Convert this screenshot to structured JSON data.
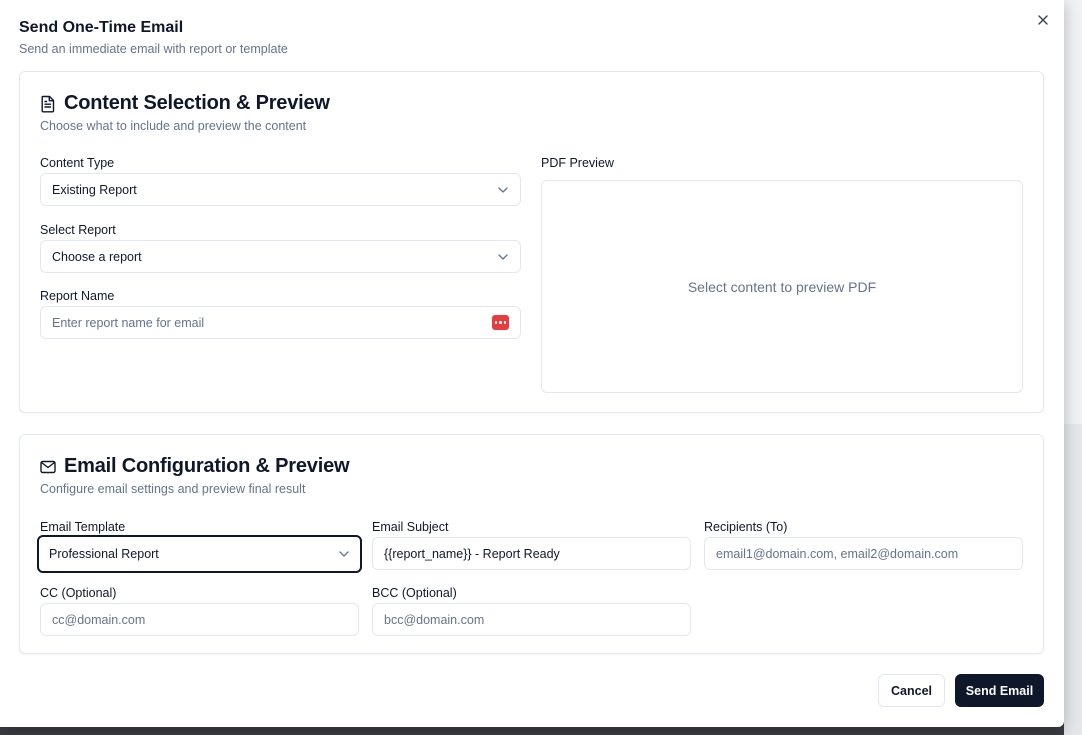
{
  "dialog": {
    "title": "Send One-Time Email",
    "description": "Send an immediate email with report or template",
    "close_icon": "close-icon"
  },
  "content_section": {
    "title": "Content Selection & Preview",
    "subtitle": "Choose what to include and preview the content",
    "icon": "file-text-icon",
    "content_type": {
      "label": "Content Type",
      "value": "Existing Report"
    },
    "select_report": {
      "label": "Select Report",
      "value": "Choose a report"
    },
    "report_name": {
      "label": "Report Name",
      "placeholder": "Enter report name for email",
      "value": ""
    },
    "pdf_preview": {
      "label": "PDF Preview",
      "message": "Select content to preview PDF"
    }
  },
  "email_section": {
    "title": "Email Configuration & Preview",
    "subtitle": "Configure email settings and preview final result",
    "icon": "mail-icon",
    "template": {
      "label": "Email Template",
      "value": "Professional Report"
    },
    "subject": {
      "label": "Email Subject",
      "value": "{{report_name}} - Report Ready"
    },
    "recipients": {
      "label": "Recipients (To)",
      "placeholder": "email1@domain.com, email2@domain.com",
      "value": ""
    },
    "cc": {
      "label": "CC (Optional)",
      "placeholder": "cc@domain.com",
      "value": ""
    },
    "bcc": {
      "label": "BCC (Optional)",
      "placeholder": "bcc@domain.com",
      "value": ""
    }
  },
  "footer": {
    "cancel_label": "Cancel",
    "send_label": "Send Email"
  },
  "colors": {
    "primary": "#0f172a",
    "muted_text": "#64748b",
    "border": "#e2e8f0",
    "password_manager_badge": "#e53e3e"
  }
}
